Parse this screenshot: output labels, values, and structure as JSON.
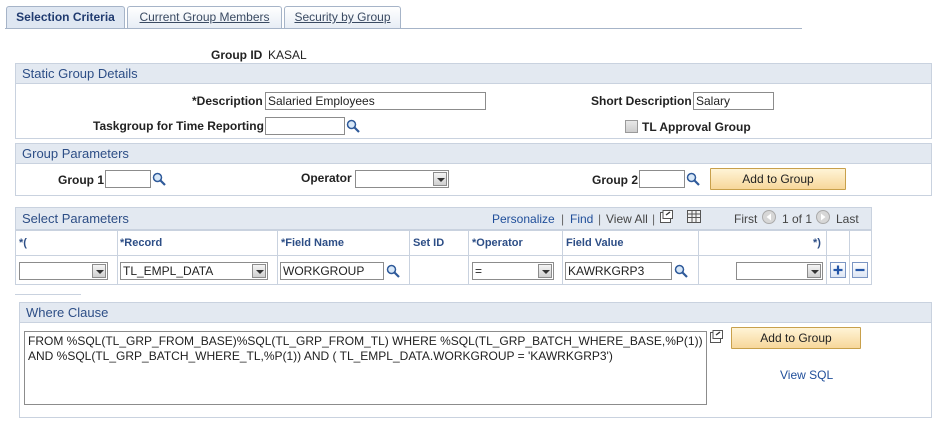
{
  "tabs": [
    {
      "label": "Selection Criteria"
    },
    {
      "label": "Current Group Members"
    },
    {
      "label": "Security by Group"
    }
  ],
  "group_id": {
    "label": "Group ID",
    "value": "KASAL"
  },
  "static_group": {
    "title": "Static Group Details",
    "description_label": "*Description",
    "description_value": "Salaried Employees",
    "short_description_label": "Short Description",
    "short_description_value": "Salary",
    "taskgroup_label": "Taskgroup for Time Reporting",
    "taskgroup_value": "",
    "tl_approval_label": "TL Approval Group"
  },
  "group_params": {
    "title": "Group Parameters",
    "group1_label": "Group 1",
    "group1_value": "",
    "operator_label": "Operator",
    "operator_value": "",
    "group2_label": "Group 2",
    "group2_value": "",
    "add_button": "Add to Group"
  },
  "select_params": {
    "title": "Select Parameters",
    "personalize": "Personalize",
    "find": "Find",
    "view_all": "View All",
    "separator": "|",
    "first": "First",
    "range": "1 of 1",
    "last": "Last",
    "columns": [
      "*(",
      "*Record",
      "*Field Name",
      "Set ID",
      "*Operator",
      "Field Value",
      "*)"
    ],
    "row": {
      "open_paren": "",
      "record": "TL_EMPL_DATA",
      "field_name": "WORKGROUP",
      "set_id": "",
      "operator": "=",
      "field_value": "KAWRKGRP3",
      "close_paren": ""
    }
  },
  "where_clause": {
    "title": "Where Clause",
    "text": "FROM  %SQL(TL_GRP_FROM_BASE)%SQL(TL_GRP_FROM_TL) WHERE %SQL(TL_GRP_BATCH_WHERE_BASE,%P(1)) AND %SQL(TL_GRP_BATCH_WHERE_TL,%P(1)) AND ( TL_EMPL_DATA.WORKGROUP = 'KAWRKGRP3')",
    "add_button": "Add to Group",
    "view_sql": "View SQL"
  },
  "colors": {
    "header_bg": "#e3e9f1",
    "header_text": "#2d4e86",
    "button_bg": "#f7d79a",
    "link": "#1f4e9a"
  }
}
